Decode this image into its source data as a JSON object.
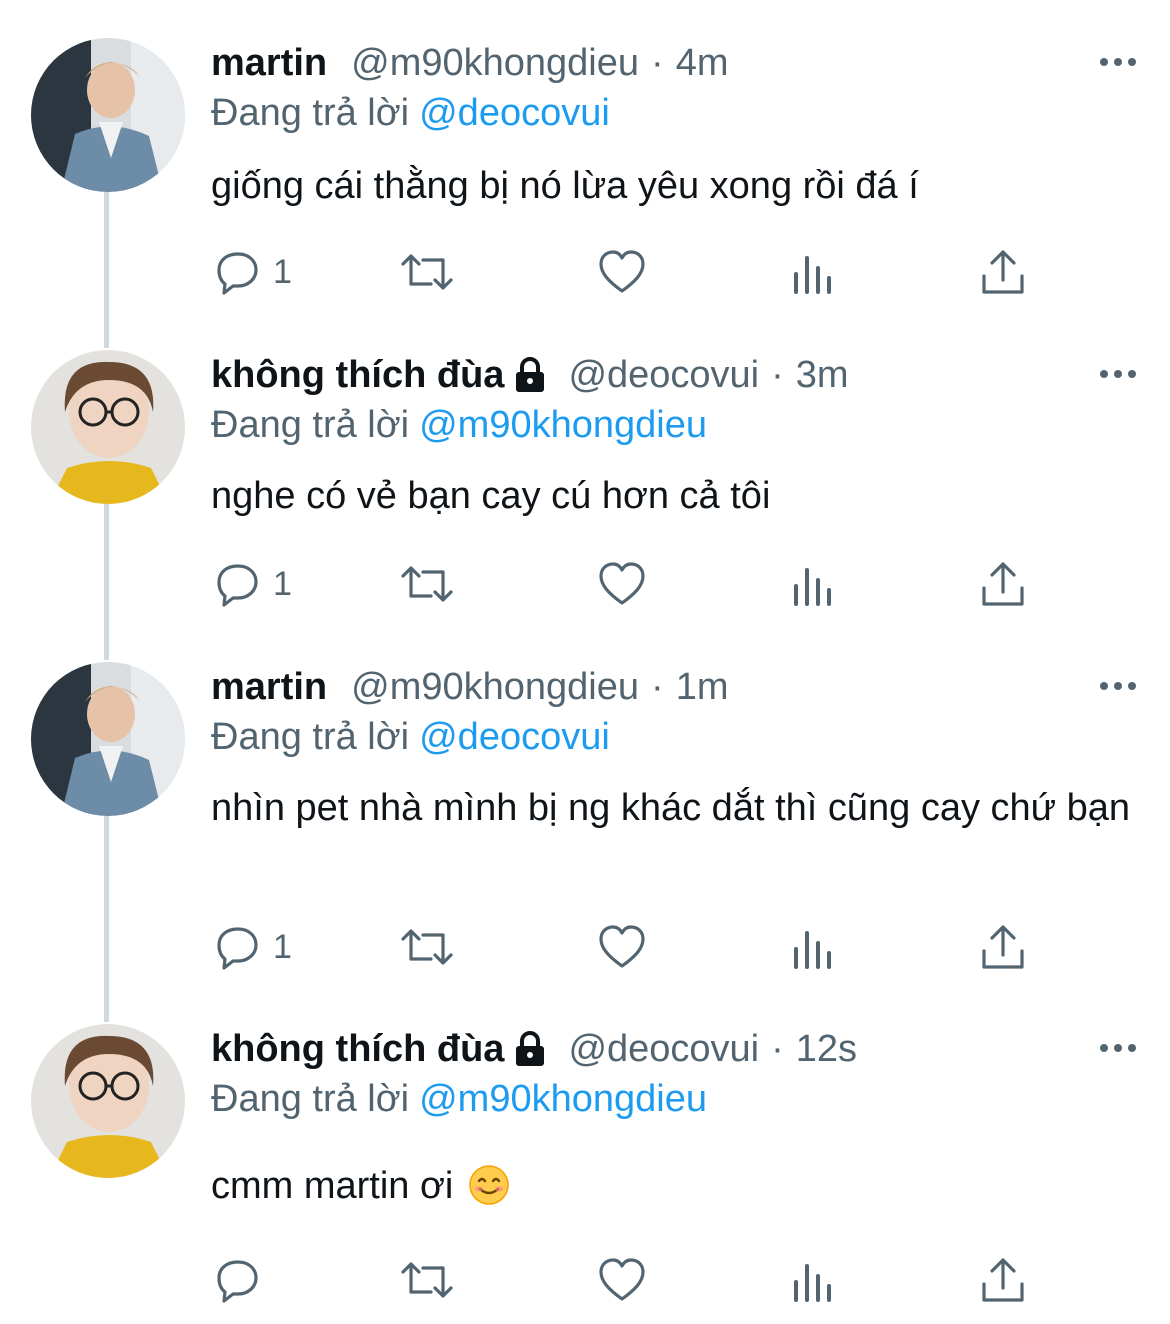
{
  "tweets": [
    {
      "name": "martin",
      "locked": false,
      "handle": "@m90khongdieu",
      "separator": "·",
      "time": "4m",
      "reply_prefix": "Đang trả lời",
      "reply_mention": "@deocovui",
      "text": "giống cái thằng bị nó lừa yêu xong rồi đá í",
      "reply_count": "1",
      "avatar": "martin"
    },
    {
      "name": "không thích đùa",
      "locked": true,
      "handle": "@deocovui",
      "separator": "·",
      "time": "3m",
      "reply_prefix": "Đang trả lời",
      "reply_mention": "@m90khongdieu",
      "text": "nghe có vẻ bạn cay cú hơn cả tôi",
      "reply_count": "1",
      "avatar": "khongthichdua"
    },
    {
      "name": "martin",
      "locked": false,
      "handle": "@m90khongdieu",
      "separator": "·",
      "time": "1m",
      "reply_prefix": "Đang trả lời",
      "reply_mention": "@deocovui",
      "text": "nhìn pet nhà mình bị ng khác dắt thì cũng cay chứ bạn",
      "reply_count": "1",
      "avatar": "martin"
    },
    {
      "name": "không thích đùa",
      "locked": true,
      "handle": "@deocovui",
      "separator": "·",
      "time": "12s",
      "reply_prefix": "Đang trả lời",
      "reply_mention": "@m90khongdieu",
      "text": "cmm martin ơi",
      "reply_count": "",
      "avatar": "khongthichdua",
      "emoji": "smiling-face-emoji"
    }
  ],
  "icons": {
    "lock": "lock-icon",
    "more": "more-dots-icon",
    "reply": "reply-bubble-icon",
    "retweet": "retweet-icon",
    "like": "heart-icon",
    "views": "bar-chart-icon",
    "share": "share-upload-icon"
  },
  "colors": {
    "text_primary": "#0f1419",
    "text_secondary": "#536471",
    "mention_blue": "#1d9bf0",
    "thread_line": "#cfd9de"
  }
}
